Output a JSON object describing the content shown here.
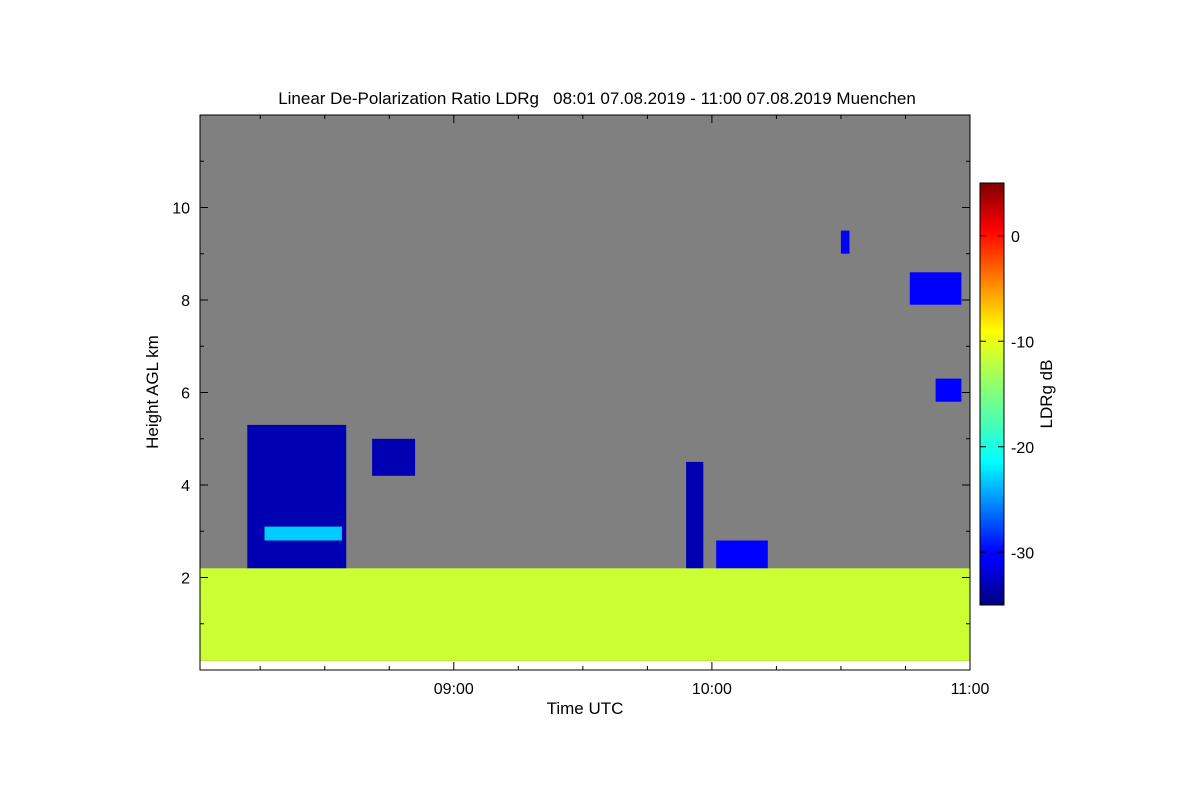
{
  "chart_data": {
    "type": "heatmap",
    "title": "Linear De-Polarization Ratio LDRg   08:01 07.08.2019 - 11:00 07.08.2019 Muenchen",
    "xlabel": "Time UTC",
    "ylabel": "Height AGL km",
    "x_range_utc": [
      "08:01",
      "11:00"
    ],
    "x_ticks": [
      "09:00",
      "10:00",
      "11:00"
    ],
    "ylim": [
      0,
      12
    ],
    "y_ticks": [
      "2",
      "4",
      "6",
      "8",
      "10"
    ],
    "background_color": "#808080",
    "colorbar": {
      "label": "LDRg dB",
      "range": [
        -35,
        5
      ],
      "ticks": [
        "0",
        "-10",
        "-20",
        "-30"
      ],
      "colormap": "jet"
    },
    "features": [
      {
        "value_db": -33,
        "t_start": "08:12",
        "t_end": "08:35",
        "z_bottom": 0.3,
        "z_top": 5.3
      },
      {
        "value_db": -33,
        "t_start": "08:41",
        "t_end": "08:51",
        "z_bottom": 4.2,
        "z_top": 5.0
      },
      {
        "value_db": -33,
        "t_start": "09:54",
        "t_end": "09:58",
        "z_bottom": 0.3,
        "z_top": 4.5
      },
      {
        "value_db": -30,
        "t_start": "10:01",
        "t_end": "10:13",
        "z_bottom": 0.3,
        "z_top": 2.8
      },
      {
        "value_db": -30,
        "t_start": "10:30",
        "t_end": "10:32",
        "z_bottom": 9.0,
        "z_top": 9.5
      },
      {
        "value_db": -30,
        "t_start": "10:46",
        "t_end": "10:58",
        "z_bottom": 7.9,
        "z_top": 8.6
      },
      {
        "value_db": -30,
        "t_start": "10:52",
        "t_end": "10:58",
        "z_bottom": 5.8,
        "z_top": 6.3
      },
      {
        "value_db": -22,
        "t_start": "08:16",
        "t_end": "08:34",
        "z_bottom": 2.8,
        "z_top": 3.1
      },
      {
        "value_db": -12,
        "t_start": "08:01",
        "t_end": "11:00",
        "z_bottom": 0.2,
        "z_top": 2.2
      }
    ]
  }
}
